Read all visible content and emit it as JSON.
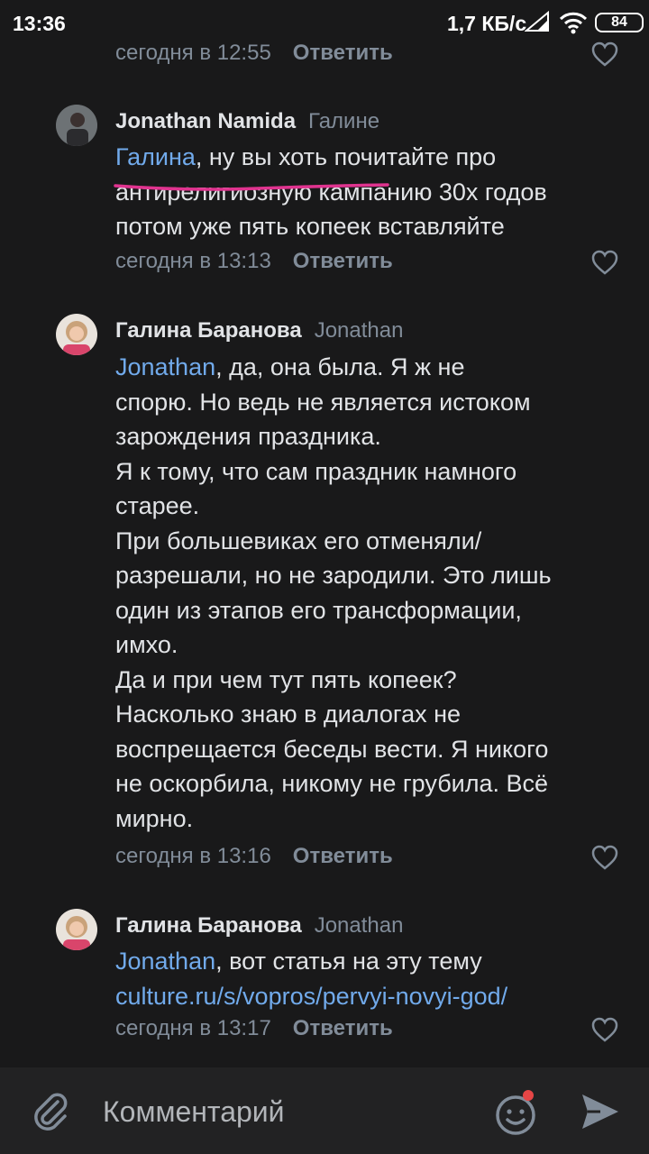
{
  "status": {
    "time": "13:36",
    "speed": "1,7 КБ/с",
    "battery": "84"
  },
  "comments": [
    {
      "time": "сегодня в 12:55",
      "reply": "Ответить"
    },
    {
      "author": "Jonathan Namida",
      "to": "Галине",
      "mention": "Галина",
      "lines": [
        ", ну вы хоть почитайте про",
        "антирелигиозную кампанию 30х годов",
        "потом уже пять копеек вставляйте"
      ],
      "time": "сегодня в 13:13",
      "reply": "Ответить"
    },
    {
      "author": "Галина Баранова",
      "to": "Jonathan",
      "mention": "Jonathan",
      "lines": [
        ", да, она была. Я ж не",
        "спорю. Но ведь не является истоком",
        "зарождения праздника.",
        "Я к тому, что сам праздник намного",
        "старее.",
        "При большевиках его отменяли/",
        "разрешали, но не зародили. Это лишь",
        "один из этапов его трансформации,",
        "имхо.",
        "Да и при чем тут пять копеек?",
        "Насколько знаю в диалогах не",
        "воспрещается беседы вести. Я никого",
        "не оскорбила, никому не грубила. Всё",
        "мирно."
      ],
      "time": "сегодня в 13:16",
      "reply": "Ответить"
    },
    {
      "author": "Галина Баранова",
      "to": "Jonathan",
      "mention": "Jonathan",
      "lines": [
        ", вот статья на эту тему"
      ],
      "link": "culture.ru/s/vopros/pervyi-novyi-god/",
      "time": "сегодня в 13:17",
      "reply": "Ответить"
    }
  ],
  "input": {
    "placeholder": "Комментарий"
  },
  "colors": {
    "background": "#19191a",
    "link": "#71aaeb",
    "muted": "#818c99",
    "highlight": "#e0338f",
    "notification": "#e64646"
  }
}
